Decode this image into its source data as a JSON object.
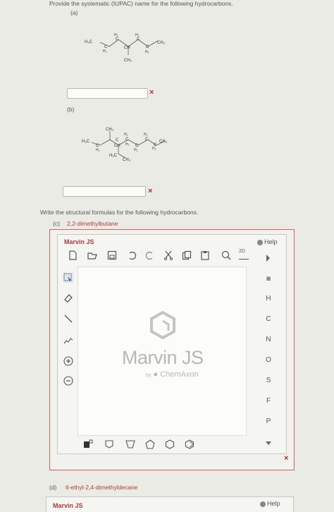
{
  "instructions": {
    "naming": "Provide the systematic (IUPAC) name for the following hydrocarbons.",
    "structural": "Write the structural formulas for the following hydrocarbons."
  },
  "questions": {
    "a": {
      "label": "(a)",
      "atoms": [
        "H₃C",
        "H₂",
        "C",
        "H₂",
        "C",
        "CH",
        "CH₃",
        "C",
        "H₂",
        "C",
        "H₂",
        "CH₃"
      ]
    },
    "b": {
      "label": "(b)",
      "atoms": [
        "CH₃",
        "H₃C",
        "C",
        "H₂",
        "CH",
        "H₂",
        "C",
        "H₂",
        "C",
        "H₂",
        "C",
        "CH₃",
        "H₂C",
        "CH₃",
        "H₂",
        "C",
        "C",
        "H₂"
      ]
    },
    "c": {
      "label": "(c)",
      "name": "2,2-dimethylbutane"
    },
    "d": {
      "label": "(d)",
      "name": "6-ethyl-2,4-dimethyldecane"
    }
  },
  "marvin": {
    "title": "Marvin JS",
    "help": "Help",
    "logo_main": "Marvin JS",
    "logo_by": "by",
    "logo_brand": "ChemAxon",
    "view_mode": "2D",
    "elements": [
      "H",
      "C",
      "N",
      "O",
      "S",
      "F",
      "P"
    ],
    "icons": {
      "toolbar": [
        "new-document-icon",
        "open-folder-icon",
        "save-icon",
        "undo-icon",
        "redo-icon",
        "cut-icon",
        "copy-icon",
        "paste-icon",
        "zoom-icon",
        "2d-clean-icon",
        "expand-arrow-icon"
      ],
      "left": [
        "select-icon",
        "eraser-icon",
        "bond-icon",
        "chain-icon",
        "charge-plus-icon",
        "charge-minus-icon"
      ],
      "bottom": [
        "atom-template-icon",
        "ring-template-icon",
        "cyclopentane-icon",
        "pentagon-icon",
        "hexagon-icon",
        "benzene-icon"
      ]
    }
  },
  "second_marvin": {
    "title": "Marvin JS",
    "help": "Help"
  },
  "status": {
    "incorrect_mark": "×"
  }
}
